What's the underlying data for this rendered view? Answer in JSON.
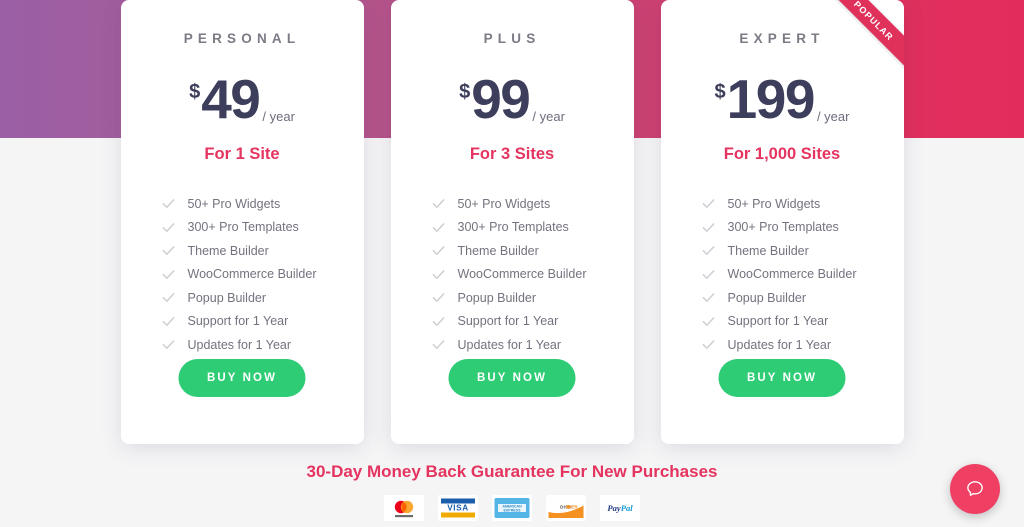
{
  "theme": {
    "gradient_start": "#9a5fa4",
    "gradient_end": "#e22d5c",
    "accent_pink": "#e4345f",
    "price_color": "#3d3d5c",
    "button_green": "#2fcc76",
    "page_bg": "#f5f5f6"
  },
  "plans": [
    {
      "name": "PERSONAL",
      "currency": "$",
      "amount": "49",
      "period": "/ year",
      "sites": "For 1 Site",
      "features": [
        "50+ Pro Widgets",
        "300+ Pro Templates",
        "Theme Builder",
        "WooCommerce Builder",
        "Popup Builder",
        "Support for 1 Year",
        "Updates for 1 Year"
      ],
      "cta": "BUY NOW",
      "popular": false,
      "ribbon_label": ""
    },
    {
      "name": "PLUS",
      "currency": "$",
      "amount": "99",
      "period": "/ year",
      "sites": "For 3 Sites",
      "features": [
        "50+ Pro Widgets",
        "300+ Pro Templates",
        "Theme Builder",
        "WooCommerce Builder",
        "Popup Builder",
        "Support for 1 Year",
        "Updates for 1 Year"
      ],
      "cta": "BUY NOW",
      "popular": false,
      "ribbon_label": ""
    },
    {
      "name": "EXPERT",
      "currency": "$",
      "amount": "199",
      "period": "/ year",
      "sites": "For 1,000 Sites",
      "features": [
        "50+ Pro Widgets",
        "300+ Pro Templates",
        "Theme Builder",
        "WooCommerce Builder",
        "Popup Builder",
        "Support for 1 Year",
        "Updates for 1 Year"
      ],
      "cta": "BUY NOW",
      "popular": true,
      "ribbon_label": "POPULAR"
    }
  ],
  "footer": {
    "guarantee": "30-Day Money Back Guarantee For New Purchases",
    "payment_methods": [
      {
        "name": "mastercard-logo",
        "label": "mastercard"
      },
      {
        "name": "visa-logo",
        "label": "VISA"
      },
      {
        "name": "amex-logo",
        "label": "AMERICAN EXPRESS"
      },
      {
        "name": "discover-logo",
        "label": "DISCOVER"
      },
      {
        "name": "paypal-logo",
        "label": "PayPal"
      }
    ]
  },
  "help_widget": {
    "icon": "chat-bubble-icon",
    "color": "#ef3f63"
  }
}
